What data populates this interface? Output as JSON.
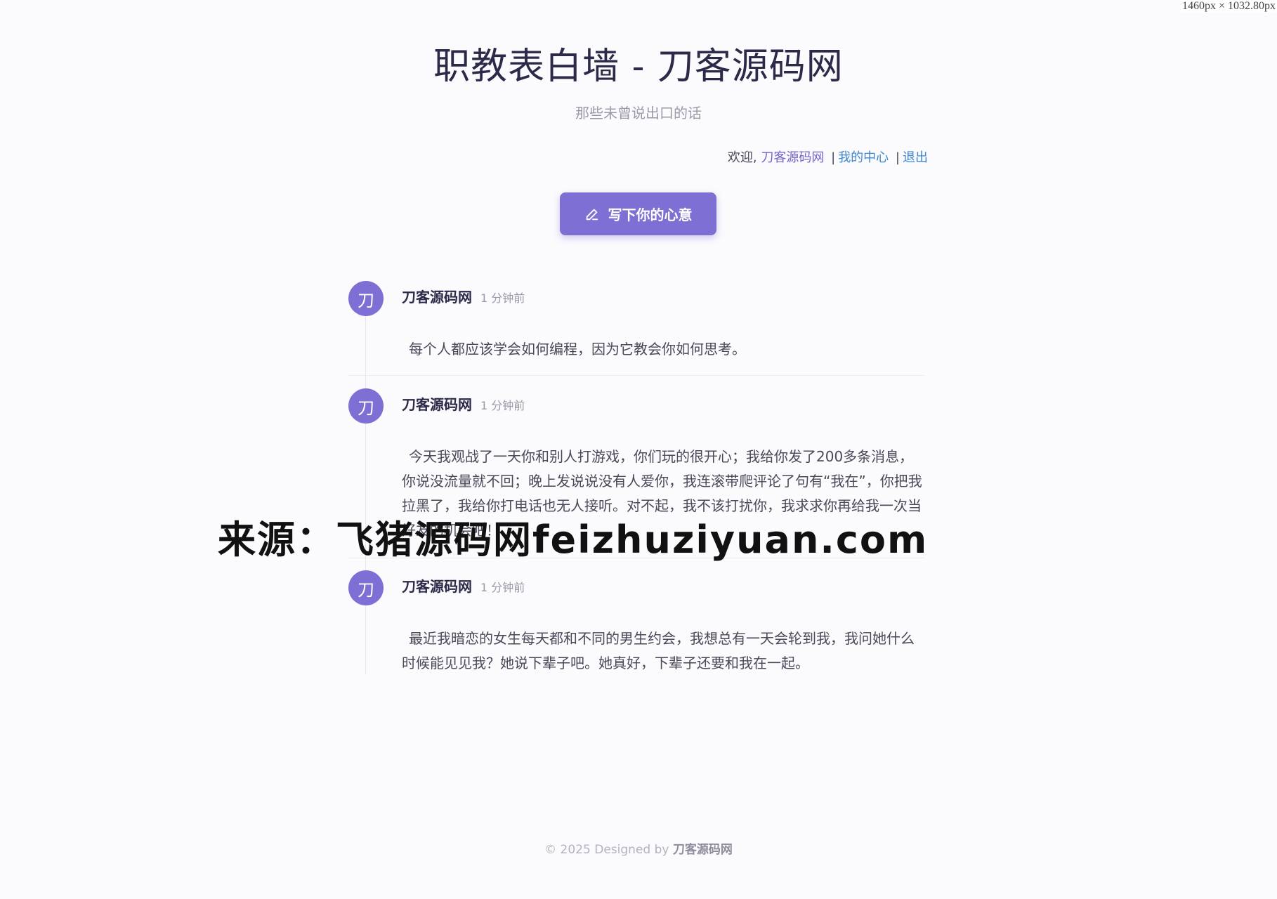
{
  "viewport_label": "1460px × 1032.80px",
  "header": {
    "title": "职教表白墙 - 刀客源码网",
    "subtitle": "那些未曾说出口的话"
  },
  "userbar": {
    "welcome": "欢迎,",
    "username": "刀客源码网",
    "separator": "|",
    "my_center": "我的中心",
    "logout": "退出"
  },
  "write_button": {
    "label": "写下你的心意",
    "icon": "pencil-icon"
  },
  "posts": [
    {
      "avatar": "刀",
      "author": "刀客源码网",
      "time": "1 分钟前",
      "content": "每个人都应该学会如何编程，因为它教会你如何思考。"
    },
    {
      "avatar": "刀",
      "author": "刀客源码网",
      "time": "1 分钟前",
      "content": "今天我观战了一天你和别人打游戏，你们玩的很开心；我给你发了200多条消息，你说没流量就不回；晚上发说说没有人爱你，我连滚带爬评论了句有“我在”，你把我拉黑了，我给你打电话也无人接听。对不起，我不该打扰你，我求求你再给我一次当好友的机会吧！"
    },
    {
      "avatar": "刀",
      "author": "刀客源码网",
      "time": "1 分钟前",
      "content": "最近我暗恋的女生每天都和不同的男生约会，我想总有一天会轮到我，我问她什么时候能见见我？她说下辈子吧。她真好，下辈子还要和我在一起。"
    }
  ],
  "footer": {
    "text": "© 2025 Designed by",
    "brand": "刀客源码网"
  },
  "watermark": "来源：飞猪源码网feizhuziyuan.com",
  "colors": {
    "accent": "#7d6fd3",
    "link_blue": "#3f87cf",
    "background": "#fbfafd"
  }
}
